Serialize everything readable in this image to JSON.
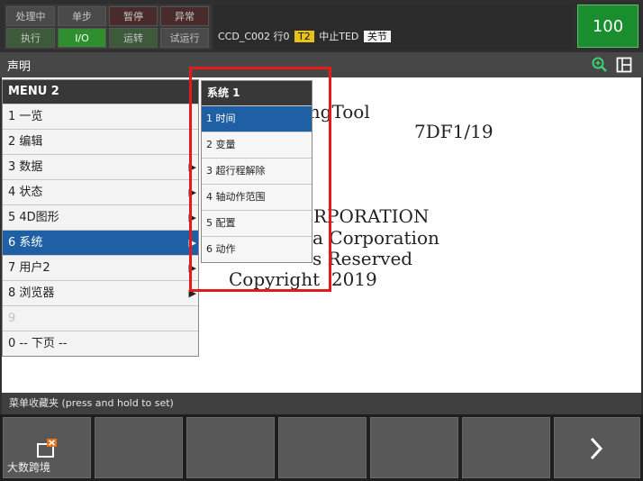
{
  "status_buttons": [
    {
      "label": "处理中",
      "bg": "#4a4a4a",
      "color": "#c6c6c6"
    },
    {
      "label": "单步",
      "bg": "#4a4a4a",
      "color": "#c6c6c6"
    },
    {
      "label": "暂停",
      "bg": "#4a2b2b",
      "color": "#c6c6c6"
    },
    {
      "label": "异常",
      "bg": "#4a2b2b",
      "color": "#c6c6c6"
    },
    {
      "label": "执行",
      "bg": "#3d5a3a",
      "color": "#c6c6c6"
    },
    {
      "label": "I/O",
      "bg": "#2f8f2f",
      "color": "#ffffff"
    },
    {
      "label": "运转",
      "bg": "#3d5a3a",
      "color": "#c6c6c6"
    },
    {
      "label": "试运行",
      "bg": "#4a4a4a",
      "color": "#c6c6c6"
    }
  ],
  "top_info": {
    "program": "CCD_C002",
    "line": "行0",
    "task": "T2",
    "status": "中止TED",
    "joint": "关节"
  },
  "override": "100",
  "title": "声明",
  "background_lines": [
    "lingTool",
    "7DF1/19",
    "RPORATION",
    "a Corporation",
    "s Reserved",
    "Copyright  2019"
  ],
  "menu": {
    "header": "MENU  2",
    "items": [
      {
        "label": "1 一览",
        "arrow": false
      },
      {
        "label": "2 编辑",
        "arrow": false
      },
      {
        "label": "3 数据",
        "arrow": true
      },
      {
        "label": "4 状态",
        "arrow": true
      },
      {
        "label": "5 4D图形",
        "arrow": true
      },
      {
        "label": "6 系统",
        "arrow": true
      },
      {
        "label": "7 用户2",
        "arrow": true
      },
      {
        "label": "8 浏览器",
        "arrow": true
      },
      {
        "label": "9",
        "arrow": false
      },
      {
        "label": "0 -- 下页 --",
        "arrow": false
      }
    ],
    "selected": "6 系统"
  },
  "submenu": {
    "header": "系统   1",
    "items": [
      "1 时间",
      "2 变量",
      "3 超行程解除",
      "4 轴动作范围",
      "5 配置",
      "6 动作"
    ],
    "selected": "1 时间"
  },
  "status_line": "菜单收藏夹 (press and hold to set)",
  "watermark": "大数跨境",
  "colors": {
    "highlight": "#1f5fa3",
    "annotation": "#e31b1b",
    "override_bg": "#1a8d2f"
  },
  "icons": [
    "zoom-in-icon",
    "layout-icon",
    "file-close-icon",
    "next-page-icon"
  ]
}
